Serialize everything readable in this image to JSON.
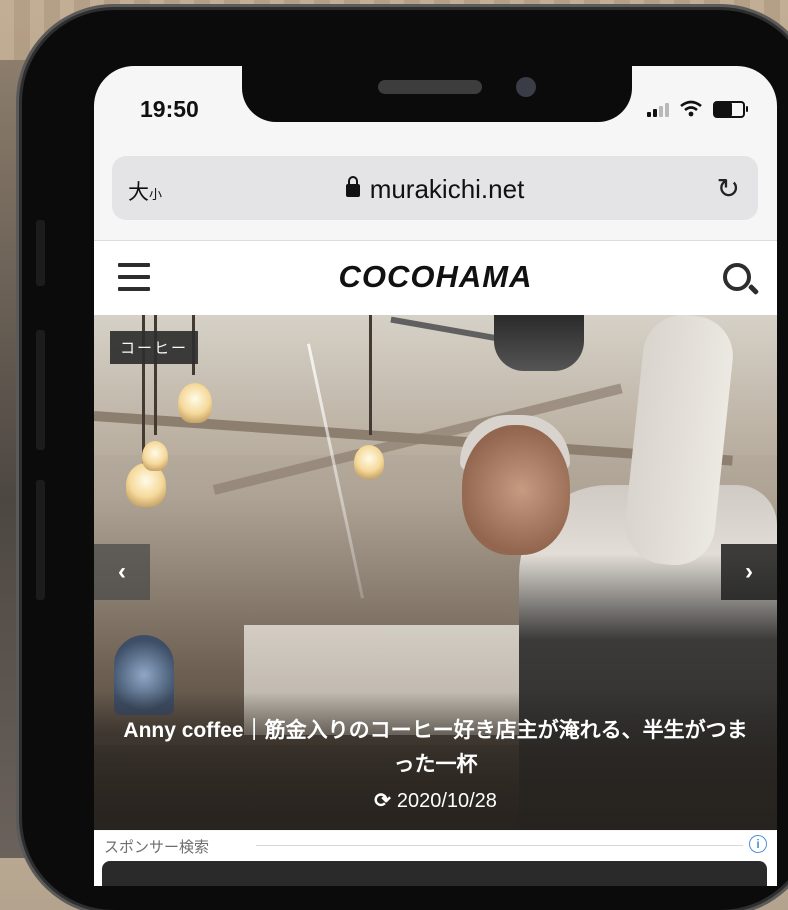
{
  "status_bar": {
    "time": "19:50"
  },
  "address_bar": {
    "text_size_label": "大",
    "text_size_small": "小",
    "url": "murakichi.net"
  },
  "site_header": {
    "brand": "COCOHAMA"
  },
  "hero": {
    "category": "コーヒー",
    "title": "Anny coffee｜筋金入りのコーヒー好き店主が淹れる、半生がつまった一杯",
    "date": "2020/10/28",
    "prev_arrow": "‹",
    "next_arrow": "›"
  },
  "sponsor": {
    "label": "スポンサー検索",
    "info": "i"
  },
  "icons": [
    "menu-icon",
    "search-icon",
    "lock-icon",
    "reload-icon",
    "refresh-icon",
    "wifi-icon",
    "signal-icon",
    "battery-icon",
    "info-icon"
  ],
  "colors": {
    "header_bg": "#ffffff",
    "badge_bg": "#2f2f2f",
    "info_blue": "#4a90d9",
    "phone_frame": "#0b0b0b"
  }
}
